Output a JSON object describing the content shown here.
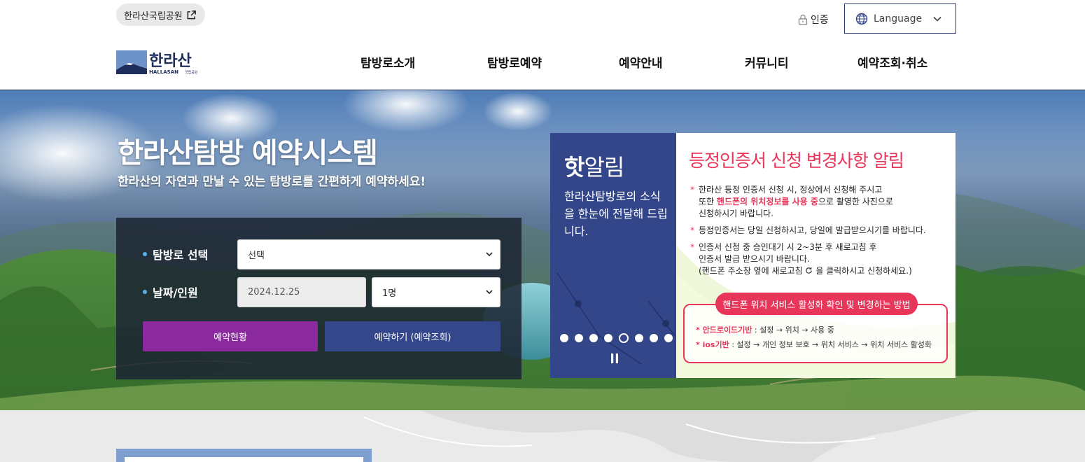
{
  "header": {
    "park_link": "한라산국립공원",
    "auth_label": "인증",
    "language_label": "Language",
    "logo_text_kr": "한라산",
    "logo_text_en": "HALLASAN",
    "logo_text_small": "국립공원"
  },
  "nav": {
    "items": [
      {
        "label": "탐방로소개"
      },
      {
        "label": "탐방로예약"
      },
      {
        "label": "예약안내"
      },
      {
        "label": "커뮤니티"
      },
      {
        "label": "예약조회·취소"
      }
    ]
  },
  "hero": {
    "title": "한라산탐방 예약시스템",
    "subtitle": "한라산의 자연과 만날 수 있는 탐방로를 간편하게 예약하세요!"
  },
  "reservation": {
    "trail_label": "탐방로 선택",
    "trail_value": "선택",
    "date_label": "날짜/인원",
    "date_value": "2024.12.25",
    "people_value": "1명",
    "status_button": "예약현황",
    "reserve_button": "예약하기 (예약조회)"
  },
  "notice": {
    "title_bold": "핫",
    "title_rest": "알림",
    "description": "한라산탐방로의 소식을 한눈에 전달해 드립니다.",
    "slide_count": 8,
    "active_slide": 5,
    "banner_title": "등정인증서 신청 변경사항 알림",
    "items": {
      "i1a": "한라산 등정 인증서 신청 시, 정상에서 신청해 주시고",
      "i1b": "또한 ",
      "i1hl": "핸드폰의 위치정보를 사용 중",
      "i1c": "으로 촬영한 사진으로",
      "i1d": "신청하시기 바랍니다.",
      "i2": "등정인증서는 당일 신청하시고, 당일에 발급받으시기를 바랍니다.",
      "i3a": "인증서 신청 중 승인대기 시 2~3분 후 새로고침 후",
      "i3b": "인증서 발급 받으시기 바랍니다.",
      "i3c": "(핸드폰 주소창 옆에 새로고침 ",
      "i3d": " 을 클릭하시고 신청하세요.)"
    },
    "help_badge": "핸드폰 위치 서비스 활성화 확인 및 변경하는 방법",
    "android_key": "* 안드로이드기반",
    "android_val": " : 설정 → 위치 → 사용 중",
    "ios_key": "* ios기반",
    "ios_val": " : 설정 → 개인 정보 보호 → 위치 서비스 → 위치 서비스 활성화"
  },
  "colors": {
    "navy": "#33468a",
    "purple": "#8b2a9f",
    "accent_red": "#e8365a",
    "bullet_blue": "#5ab4e8"
  }
}
